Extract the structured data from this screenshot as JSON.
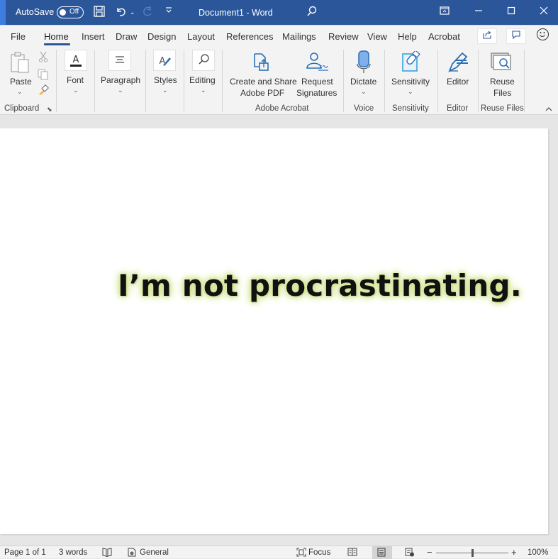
{
  "titlebar": {
    "autosave_label": "AutoSave",
    "autosave_state": "Off",
    "title": "Document1 - Word",
    "icons": [
      "save-icon",
      "undo-icon",
      "redo-icon",
      "customize-qat-icon",
      "search-icon",
      "ribbon-display-icon",
      "minimize-icon",
      "maximize-icon",
      "close-icon"
    ]
  },
  "tabs": {
    "items": [
      "File",
      "Home",
      "Insert",
      "Draw",
      "Design",
      "Layout",
      "References",
      "Mailings",
      "Review",
      "View",
      "Help",
      "Acrobat"
    ],
    "active": "Home"
  },
  "ribbon": {
    "clipboard": {
      "paste": "Paste",
      "group": "Clipboard"
    },
    "font": {
      "label": "Font"
    },
    "paragraph": {
      "label": "Paragraph"
    },
    "styles": {
      "label": "Styles"
    },
    "editing": {
      "label": "Editing"
    },
    "acrobat": {
      "create_line1": "Create and Share",
      "create_line2": "Adobe PDF",
      "request_line1": "Request",
      "request_line2": "Signatures",
      "group": "Adobe Acrobat"
    },
    "voice": {
      "dictate": "Dictate",
      "group": "Voice"
    },
    "sensitivity": {
      "label": "Sensitivity",
      "group": "Sensitivity"
    },
    "editor": {
      "label": "Editor",
      "group": "Editor"
    },
    "reuse": {
      "line1": "Reuse",
      "line2": "Files",
      "group": "Reuse Files"
    }
  },
  "document": {
    "text": "I’m not procrastinating."
  },
  "statusbar": {
    "page": "Page 1 of 1",
    "words": "3 words",
    "sensitivity": "General",
    "focus": "Focus",
    "zoom": "100%",
    "zoom_percent": 100
  },
  "colors": {
    "brand": "#2b579a",
    "text_glow": "#c9de7a"
  }
}
